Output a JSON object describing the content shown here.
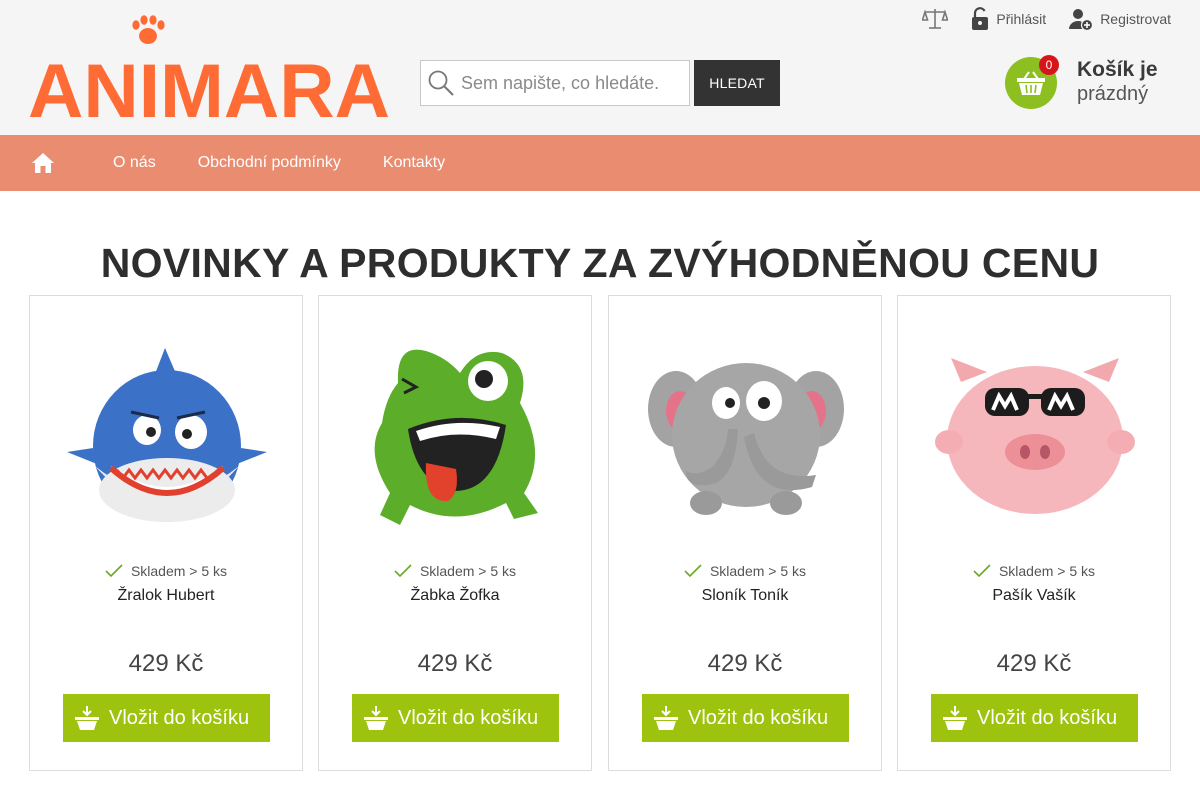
{
  "brand": {
    "name": "ANIMARA",
    "accent": "#ff6b35"
  },
  "top_links": {
    "compare_icon": "scales-icon",
    "login_label": "Přihlásit",
    "register_label": "Registrovat"
  },
  "search": {
    "placeholder": "Sem napište, co hledáte.",
    "value": "",
    "button_label": "HLEDAT"
  },
  "cart": {
    "count": "0",
    "title": "Košík je",
    "subtitle": "prázdný",
    "color": "#8cbf1f"
  },
  "nav": {
    "color": "#e98c6f",
    "items": [
      {
        "label": "O nás"
      },
      {
        "label": "Obchodní podmínky"
      },
      {
        "label": "Kontakty"
      }
    ]
  },
  "main": {
    "title": "NOVINKY A PRODUKTY ZA ZVÝHODNĚNOU CENU",
    "products": [
      {
        "name": "Žralok Hubert",
        "stock": "Skladem > 5 ks",
        "price": "429 Kč",
        "button": "Vložit do košíku",
        "image": "shark-plush"
      },
      {
        "name": "Žabka Žofka",
        "stock": "Skladem > 5 ks",
        "price": "429 Kč",
        "button": "Vložit do košíku",
        "image": "frog-plush"
      },
      {
        "name": "Sloník Toník",
        "stock": "Skladem > 5 ks",
        "price": "429 Kč",
        "button": "Vložit do košíku",
        "image": "elephant-plush"
      },
      {
        "name": "Pašík Vašík",
        "stock": "Skladem > 5 ks",
        "price": "429 Kč",
        "button": "Vložit do košíku",
        "image": "pig-plush"
      }
    ]
  },
  "button_color": "#9dc30f"
}
